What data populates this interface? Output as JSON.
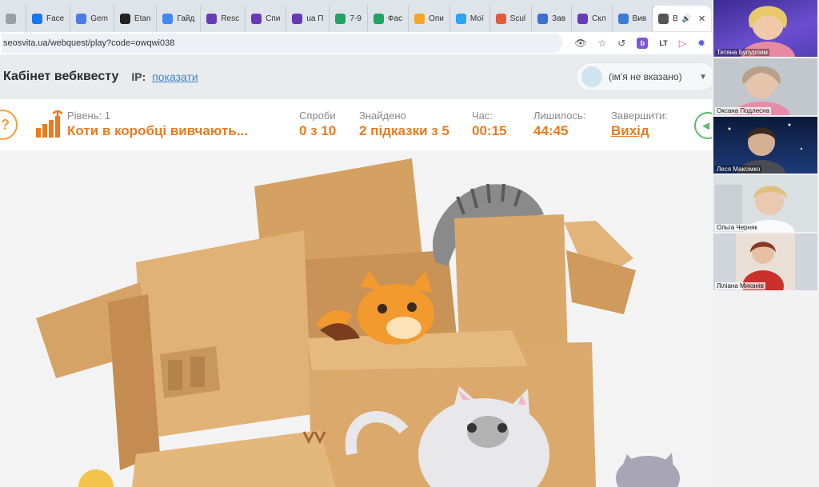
{
  "tabs": [
    {
      "label": "",
      "icon": "generic-icon",
      "color": "#9aa0a6"
    },
    {
      "label": "Face",
      "icon": "facebook-icon",
      "color": "#1877f2"
    },
    {
      "label": "Gem",
      "icon": "gemini-icon",
      "color": "#4b7be5"
    },
    {
      "label": "Etan",
      "icon": "openai-icon",
      "color": "#222222"
    },
    {
      "label": "Гайд",
      "icon": "docs-icon",
      "color": "#4285f4"
    },
    {
      "label": "Resc",
      "icon": "form-icon",
      "color": "#673ab7"
    },
    {
      "label": "Спи",
      "icon": "form-icon",
      "color": "#673ab7"
    },
    {
      "label": "ua П",
      "icon": "form-icon",
      "color": "#673ab7"
    },
    {
      "label": "7-9",
      "icon": "drive-icon",
      "color": "#1fa463"
    },
    {
      "label": "Фас",
      "icon": "drive-icon",
      "color": "#1fa463"
    },
    {
      "label": "Опи",
      "icon": "miro-icon",
      "color": "#f6a623"
    },
    {
      "label": "Мої",
      "icon": "puzzle-icon",
      "color": "#2ea3f2"
    },
    {
      "label": "Scul",
      "icon": "sculpt-icon",
      "color": "#e25c3b"
    },
    {
      "label": "Зав",
      "icon": "classroom-icon",
      "color": "#3b6fd6"
    },
    {
      "label": "Скл",
      "icon": "form-icon",
      "color": "#673ab7"
    },
    {
      "label": "Вив",
      "icon": "snowflake-icon",
      "color": "#3a7bd5"
    },
    {
      "label": "В",
      "icon": "speaker-icon",
      "color": "#555555",
      "active": true
    }
  ],
  "address": {
    "url": "seosvita.ua/webquest/play?code=owqwi038"
  },
  "header": {
    "title": "Кабінет вебквесту",
    "ip_label": "IP:",
    "ip_link": "показати",
    "user": "(ім'я не вказано)"
  },
  "stats": {
    "help_label": "?",
    "level_label": "Рівень: 1",
    "level_title": "Коти в коробці вивчають...",
    "attempts_label": "Спроби",
    "attempts_value": "0 з 10",
    "found_label": "Знайдено",
    "found_value": "2 підказки з 5",
    "time_label": "Час:",
    "time_value": "00:15",
    "left_label": "Лишилось:",
    "left_value": "44:45",
    "finish_label": "Завершити:",
    "finish_value": "Вихід"
  },
  "participants": [
    {
      "name": "Тетяна Бупурлим"
    },
    {
      "name": "Оксана Подлесна"
    },
    {
      "name": "Леся Максімко"
    },
    {
      "name": "Ольга Черняк"
    },
    {
      "name": "Ліліана Миханів"
    }
  ],
  "colors": {
    "accent": "#ec7a1f",
    "link": "#3f84c6",
    "box": "#d9a86a",
    "sound": "#5cbd6d"
  }
}
